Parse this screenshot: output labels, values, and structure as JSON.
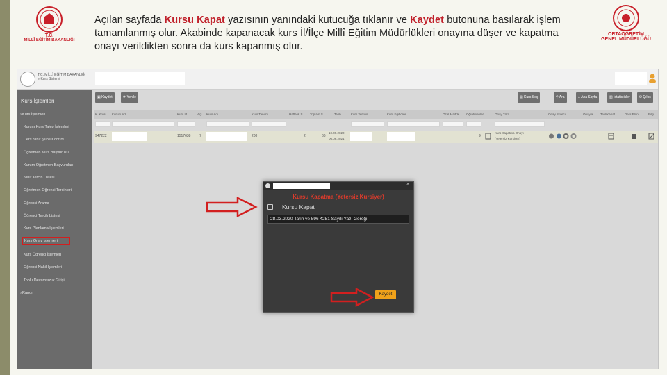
{
  "instruction": {
    "p1": "Açılan sayfada ",
    "h1": "Kursu Kapat",
    "p2": " yazısının yanındaki kutucuğa tıklanır ve ",
    "h2": "Kaydet",
    "p3": " butonuna basılarak işlem tamamlanmış olur. Akabinde kapanacak kurs İl/İlçe Millî Eğitim Müdürlükleri onayına düşer ve kapatma onayı verildikten sonra da kurs kapanmış olur."
  },
  "logo_left": {
    "line1": "T.C.",
    "line2": "MİLLÎ EĞİTİM BAKANLIĞI"
  },
  "logo_right": {
    "line1": "ORTAÖĞRETİM",
    "line2": "GENEL MÜDÜRLÜĞÜ"
  },
  "app": {
    "header_name_1": "T.C. MİLLÎ EĞİTİM BAKANLIĞI",
    "header_name_2": "e-Kurs Sistemi",
    "sidebar_title": "Kurs İşlemleri",
    "sidebar_items": [
      "»Kurs İşlemleri",
      "Kurum Kurs Talep İşlemleri",
      "Ders Sınıf Şube Kontrol",
      "Öğretmen Kurs Başvurusu",
      "Kurum Öğretmen Başvuruları",
      "Sınıf Tercih Listesi",
      "Öğretmen-Öğrenci Tercihleri",
      "Öğrenci Arama",
      "Öğrenci Tercih Listesi",
      "Kurs Planlama İşlemleri",
      "Kurs Onay İşlemleri",
      "Kurs Öğrenci İşlemleri",
      "Öğrenci Nakil İşlemleri",
      "Toplu Devamsızlık Girişi",
      "»Rapor"
    ],
    "toolbar": {
      "save": "Kaydet",
      "refresh": "Yenile",
      "course_select": "Kurs Seç",
      "search": "Ara",
      "home": "Ana Sayfa",
      "stats": "İstatistikler",
      "exit": "Çıkış"
    },
    "columns": [
      "K. Kodu",
      "Kurum Adı",
      "Kurs Id",
      "Açı",
      "Kurs Adı",
      "Kurs Tanımı",
      "Haftalık S.",
      "Toplam S.",
      "Tarih",
      "Kurs Yetkilisi",
      "Kurs Eğiticiler",
      "Özel Madde",
      "Öğretmenler",
      "Onay Türü",
      "Onay Süreci",
      "Onayla",
      "Tatil/Kapat",
      "Ders Planı",
      "Bilgi"
    ],
    "row": {
      "code": "947222",
      "course_id": "1517638",
      "open": "7",
      "definition": "208",
      "weekly": "2",
      "total": "66",
      "date1": "10.09.2020",
      "date2": "06.06.2021",
      "teachers": "9",
      "approval_1": "Kurs Kapatma Onayı",
      "approval_2": "(Yetersiz Kursiyer)"
    }
  },
  "modal": {
    "title": "Kursu Kapatma (Yetersiz Kursiyer)",
    "checkbox_label": "Kursu Kapat",
    "note": "28.03.2020 Tarih ve 596 4251 Sayılı Yazı Gereği",
    "save_label": "Kaydet",
    "close_symbol": "×"
  },
  "colors": {
    "accent_red": "#c0202a",
    "modal_title": "#e23b2b",
    "save_button": "#f0a21a",
    "sidebar": "#6b6b6b"
  }
}
